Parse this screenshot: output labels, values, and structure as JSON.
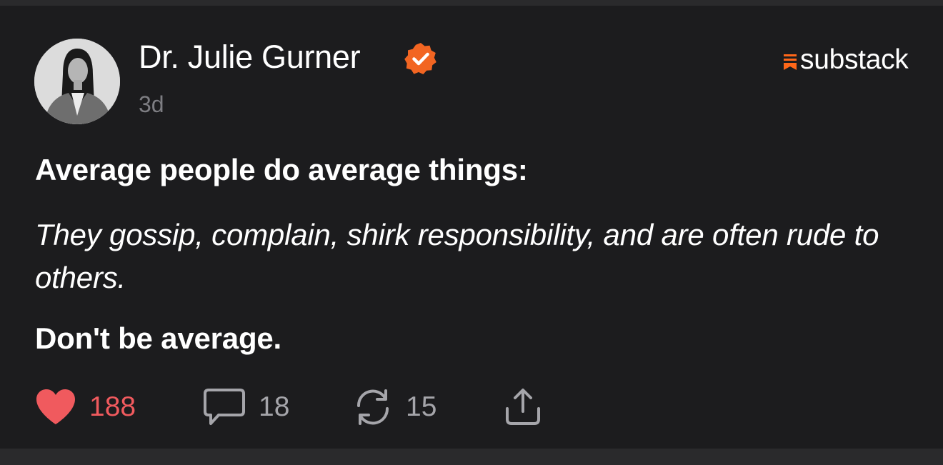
{
  "author": {
    "name": "Dr. Julie Gurner",
    "verified": true,
    "timestamp": "3d",
    "avatar_icon": "author-photo"
  },
  "brand": {
    "name": "substack",
    "accent_color": "#ff6719"
  },
  "post": {
    "paragraph_1": "Average people do average things:",
    "paragraph_2": "They gossip, complain, shirk responsibility, and are often rude to others.",
    "paragraph_3": "Don't be average."
  },
  "actions": {
    "likes": "188",
    "comments": "18",
    "restacks": "15",
    "like_icon": "heart-icon",
    "comment_icon": "comment-bubble-icon",
    "restack_icon": "restack-icon",
    "share_icon": "share-icon",
    "like_color": "#f05a5e"
  }
}
